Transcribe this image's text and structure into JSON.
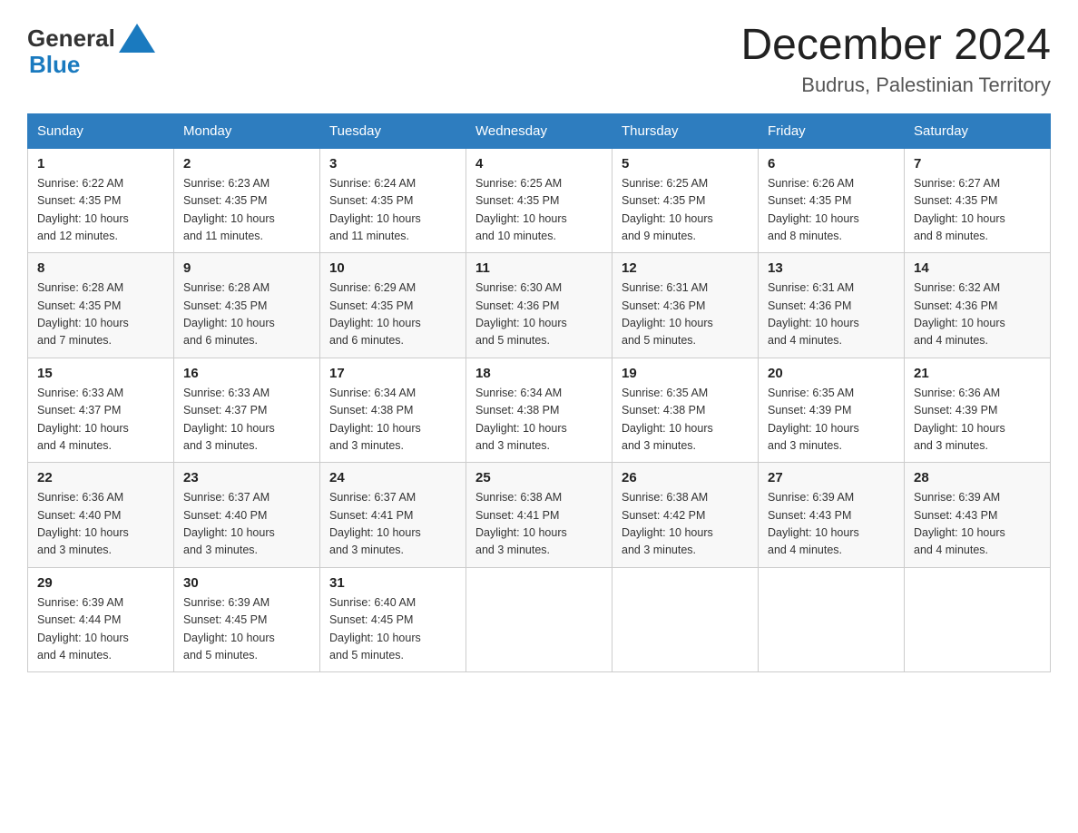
{
  "header": {
    "logo": {
      "general_text": "General",
      "blue_text": "Blue"
    },
    "month_title": "December 2024",
    "location": "Budrus, Palestinian Territory"
  },
  "days_of_week": [
    "Sunday",
    "Monday",
    "Tuesday",
    "Wednesday",
    "Thursday",
    "Friday",
    "Saturday"
  ],
  "weeks": [
    [
      {
        "day": "1",
        "sunrise": "6:22 AM",
        "sunset": "4:35 PM",
        "daylight": "10 hours and 12 minutes."
      },
      {
        "day": "2",
        "sunrise": "6:23 AM",
        "sunset": "4:35 PM",
        "daylight": "10 hours and 11 minutes."
      },
      {
        "day": "3",
        "sunrise": "6:24 AM",
        "sunset": "4:35 PM",
        "daylight": "10 hours and 11 minutes."
      },
      {
        "day": "4",
        "sunrise": "6:25 AM",
        "sunset": "4:35 PM",
        "daylight": "10 hours and 10 minutes."
      },
      {
        "day": "5",
        "sunrise": "6:25 AM",
        "sunset": "4:35 PM",
        "daylight": "10 hours and 9 minutes."
      },
      {
        "day": "6",
        "sunrise": "6:26 AM",
        "sunset": "4:35 PM",
        "daylight": "10 hours and 8 minutes."
      },
      {
        "day": "7",
        "sunrise": "6:27 AM",
        "sunset": "4:35 PM",
        "daylight": "10 hours and 8 minutes."
      }
    ],
    [
      {
        "day": "8",
        "sunrise": "6:28 AM",
        "sunset": "4:35 PM",
        "daylight": "10 hours and 7 minutes."
      },
      {
        "day": "9",
        "sunrise": "6:28 AM",
        "sunset": "4:35 PM",
        "daylight": "10 hours and 6 minutes."
      },
      {
        "day": "10",
        "sunrise": "6:29 AM",
        "sunset": "4:35 PM",
        "daylight": "10 hours and 6 minutes."
      },
      {
        "day": "11",
        "sunrise": "6:30 AM",
        "sunset": "4:36 PM",
        "daylight": "10 hours and 5 minutes."
      },
      {
        "day": "12",
        "sunrise": "6:31 AM",
        "sunset": "4:36 PM",
        "daylight": "10 hours and 5 minutes."
      },
      {
        "day": "13",
        "sunrise": "6:31 AM",
        "sunset": "4:36 PM",
        "daylight": "10 hours and 4 minutes."
      },
      {
        "day": "14",
        "sunrise": "6:32 AM",
        "sunset": "4:36 PM",
        "daylight": "10 hours and 4 minutes."
      }
    ],
    [
      {
        "day": "15",
        "sunrise": "6:33 AM",
        "sunset": "4:37 PM",
        "daylight": "10 hours and 4 minutes."
      },
      {
        "day": "16",
        "sunrise": "6:33 AM",
        "sunset": "4:37 PM",
        "daylight": "10 hours and 3 minutes."
      },
      {
        "day": "17",
        "sunrise": "6:34 AM",
        "sunset": "4:38 PM",
        "daylight": "10 hours and 3 minutes."
      },
      {
        "day": "18",
        "sunrise": "6:34 AM",
        "sunset": "4:38 PM",
        "daylight": "10 hours and 3 minutes."
      },
      {
        "day": "19",
        "sunrise": "6:35 AM",
        "sunset": "4:38 PM",
        "daylight": "10 hours and 3 minutes."
      },
      {
        "day": "20",
        "sunrise": "6:35 AM",
        "sunset": "4:39 PM",
        "daylight": "10 hours and 3 minutes."
      },
      {
        "day": "21",
        "sunrise": "6:36 AM",
        "sunset": "4:39 PM",
        "daylight": "10 hours and 3 minutes."
      }
    ],
    [
      {
        "day": "22",
        "sunrise": "6:36 AM",
        "sunset": "4:40 PM",
        "daylight": "10 hours and 3 minutes."
      },
      {
        "day": "23",
        "sunrise": "6:37 AM",
        "sunset": "4:40 PM",
        "daylight": "10 hours and 3 minutes."
      },
      {
        "day": "24",
        "sunrise": "6:37 AM",
        "sunset": "4:41 PM",
        "daylight": "10 hours and 3 minutes."
      },
      {
        "day": "25",
        "sunrise": "6:38 AM",
        "sunset": "4:41 PM",
        "daylight": "10 hours and 3 minutes."
      },
      {
        "day": "26",
        "sunrise": "6:38 AM",
        "sunset": "4:42 PM",
        "daylight": "10 hours and 3 minutes."
      },
      {
        "day": "27",
        "sunrise": "6:39 AM",
        "sunset": "4:43 PM",
        "daylight": "10 hours and 4 minutes."
      },
      {
        "day": "28",
        "sunrise": "6:39 AM",
        "sunset": "4:43 PM",
        "daylight": "10 hours and 4 minutes."
      }
    ],
    [
      {
        "day": "29",
        "sunrise": "6:39 AM",
        "sunset": "4:44 PM",
        "daylight": "10 hours and 4 minutes."
      },
      {
        "day": "30",
        "sunrise": "6:39 AM",
        "sunset": "4:45 PM",
        "daylight": "10 hours and 5 minutes."
      },
      {
        "day": "31",
        "sunrise": "6:40 AM",
        "sunset": "4:45 PM",
        "daylight": "10 hours and 5 minutes."
      },
      null,
      null,
      null,
      null
    ]
  ],
  "sunrise_label": "Sunrise:",
  "sunset_label": "Sunset:",
  "daylight_label": "Daylight:"
}
